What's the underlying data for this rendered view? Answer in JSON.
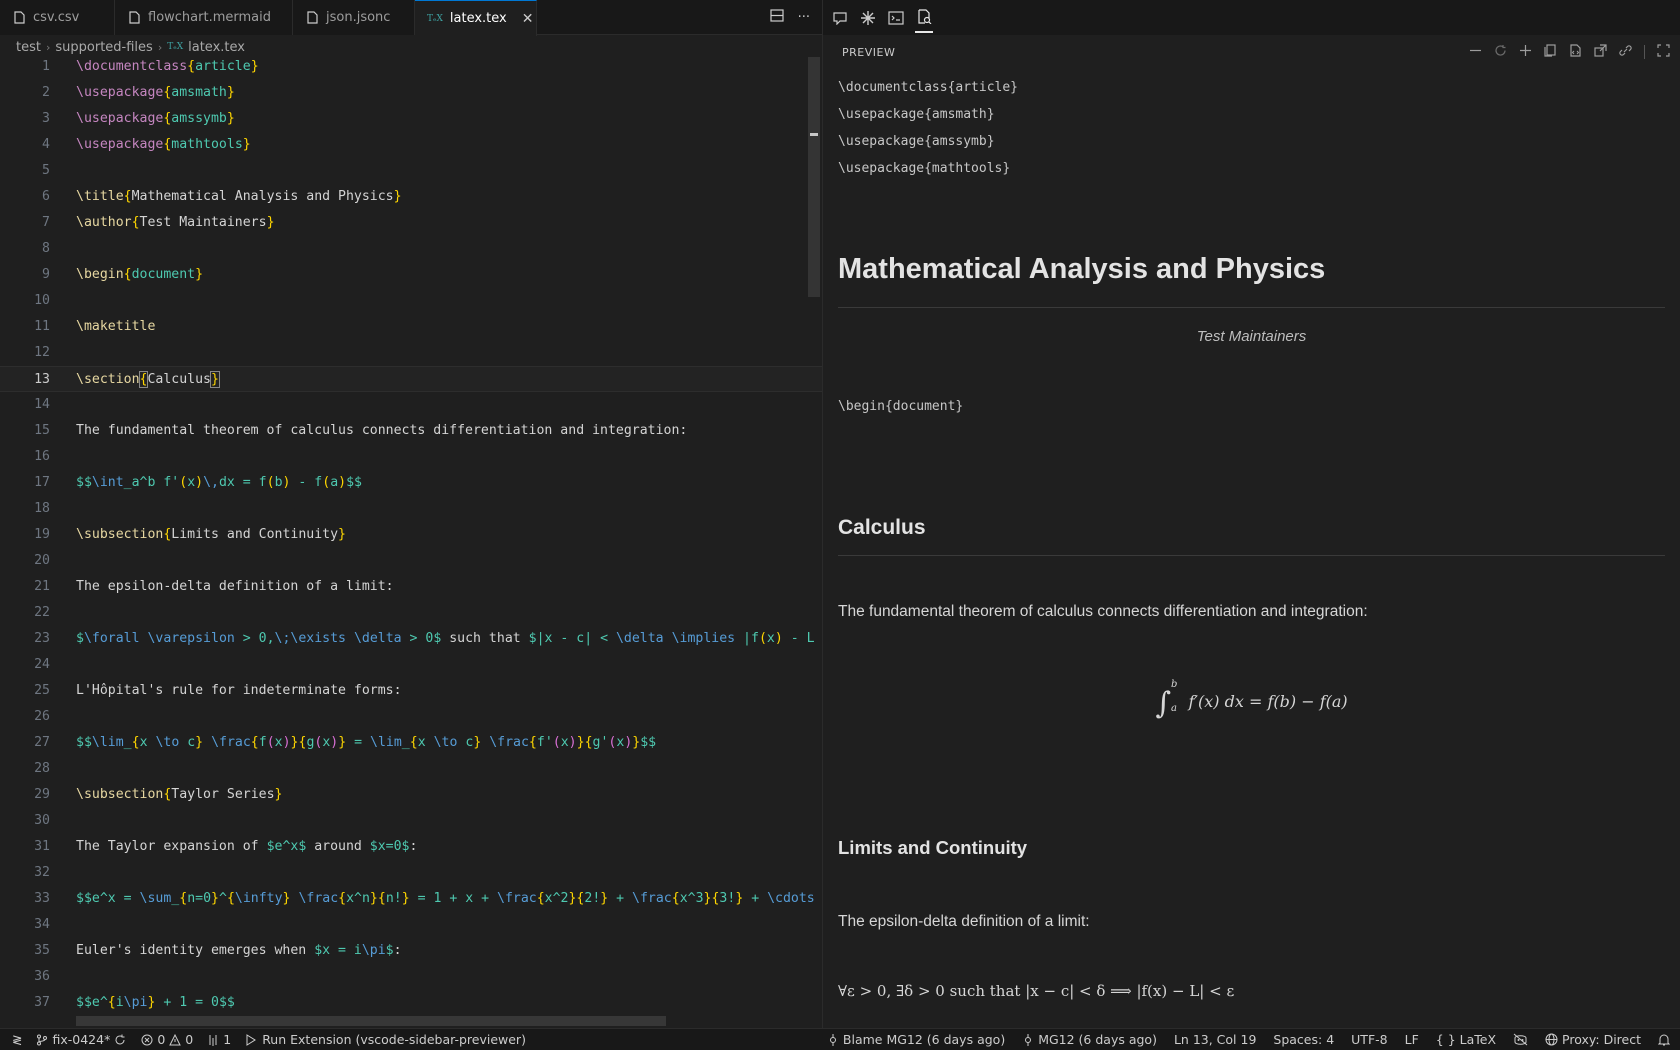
{
  "tabs": [
    {
      "label": "csv.csv",
      "icon": "file-icon",
      "active": false
    },
    {
      "label": "flowchart.mermaid",
      "icon": "file-icon",
      "active": false
    },
    {
      "label": "json.jsonc",
      "icon": "file-icon",
      "active": false
    },
    {
      "label": "latex.tex",
      "icon": "tex-icon",
      "active": true
    }
  ],
  "tab_icon_tex": "TₑX",
  "tab_close": "✕",
  "tab_actions": {
    "split": "▭",
    "more": "···"
  },
  "breadcrumb": {
    "root": "test",
    "folder": "supported-files",
    "file": "latex.tex",
    "sep": "›",
    "tex_mark": "TₑX"
  },
  "editor": {
    "current_line": 13,
    "lines": [
      {
        "n": "1",
        "html": "<span class=\"kw\">\\documentclass</span><span class=\"br\">{</span><span class=\"arg\">article</span><span class=\"br\">}</span>"
      },
      {
        "n": "2",
        "html": "<span class=\"kw\">\\usepackage</span><span class=\"br\">{</span><span class=\"arg\">amsmath</span><span class=\"br\">}</span>"
      },
      {
        "n": "3",
        "html": "<span class=\"kw\">\\usepackage</span><span class=\"br\">{</span><span class=\"arg\">amssymb</span><span class=\"br\">}</span>"
      },
      {
        "n": "4",
        "html": "<span class=\"kw\">\\usepackage</span><span class=\"br\">{</span><span class=\"arg\">mathtools</span><span class=\"br\">}</span>"
      },
      {
        "n": "5",
        "html": ""
      },
      {
        "n": "6",
        "html": "<span class=\"cmd\">\\title</span><span class=\"br\">{</span>Mathematical Analysis and Physics<span class=\"br\">}</span>"
      },
      {
        "n": "7",
        "html": "<span class=\"cmd\">\\author</span><span class=\"br\">{</span>Test Maintainers<span class=\"br\">}</span>"
      },
      {
        "n": "8",
        "html": ""
      },
      {
        "n": "9",
        "html": "<span class=\"cmd\">\\begin</span><span class=\"br\">{</span><span class=\"arg\">document</span><span class=\"br\">}</span>"
      },
      {
        "n": "10",
        "html": ""
      },
      {
        "n": "11",
        "html": "<span class=\"cmd\">\\maketitle</span>"
      },
      {
        "n": "12",
        "html": ""
      },
      {
        "n": "13",
        "html": "<span class=\"cmd\">\\section</span><span class=\"br bmatch\">{</span>Calculus<span class=\"br bmatch\">}</span>"
      },
      {
        "n": "14",
        "html": ""
      },
      {
        "n": "15",
        "html": "The fundamental theorem of calculus connects differentiation and integration:"
      },
      {
        "n": "16",
        "html": ""
      },
      {
        "n": "17",
        "html": "<span class=\"math\">$$<span class=\"mcmd\">\\int</span>_a^b f'<span class=\"br\">(</span>x<span class=\"br\">)</span><span class=\"mcmd\">\\,</span>dx = f<span class=\"br\">(</span>b<span class=\"br\">)</span> - f<span class=\"br\">(</span>a<span class=\"br\">)</span>$$</span>"
      },
      {
        "n": "18",
        "html": ""
      },
      {
        "n": "19",
        "html": "<span class=\"cmd\">\\subsection</span><span class=\"br\">{</span>Limits and Continuity<span class=\"br\">}</span>"
      },
      {
        "n": "20",
        "html": ""
      },
      {
        "n": "21",
        "html": "The epsilon-delta definition of a limit:"
      },
      {
        "n": "22",
        "html": ""
      },
      {
        "n": "23",
        "html": "<span class=\"math\">$<span class=\"mcmd\">\\forall</span> <span class=\"mcmd\">\\varepsilon</span> &gt; 0,<span class=\"mcmd\">\\;</span><span class=\"mcmd\">\\exists</span> <span class=\"mcmd\">\\delta</span> &gt; 0$</span> such that <span class=\"math\">$|x - c| &lt; <span class=\"mcmd\">\\delta</span> <span class=\"mcmd\">\\implies</span> |f<span class=\"br\">(</span>x<span class=\"br\">)</span> - L</span>"
      },
      {
        "n": "24",
        "html": ""
      },
      {
        "n": "25",
        "html": "L'Hôpital's rule for indeterminate forms:"
      },
      {
        "n": "26",
        "html": ""
      },
      {
        "n": "27",
        "html": "<span class=\"math\">$$<span class=\"mcmd\">\\lim</span>_<span class=\"br\">{</span>x <span class=\"mcmd\">\\to</span> c<span class=\"br\">}</span> <span class=\"mcmd\">\\frac</span><span class=\"br\">{</span>f<span class=\"mbr\">(</span>x<span class=\"mbr\">)</span><span class=\"br\">}{</span>g<span class=\"mbr\">(</span>x<span class=\"mbr\">)</span><span class=\"br\">}</span> = <span class=\"mcmd\">\\lim</span>_<span class=\"br\">{</span>x <span class=\"mcmd\">\\to</span> c<span class=\"br\">}</span> <span class=\"mcmd\">\\frac</span><span class=\"br\">{</span>f'<span class=\"mbr\">(</span>x<span class=\"mbr\">)</span><span class=\"br\">}{</span>g'<span class=\"mbr\">(</span>x<span class=\"mbr\">)</span><span class=\"br\">}</span>$$</span>"
      },
      {
        "n": "28",
        "html": ""
      },
      {
        "n": "29",
        "html": "<span class=\"cmd\">\\subsection</span><span class=\"br\">{</span>Taylor Series<span class=\"br\">}</span>"
      },
      {
        "n": "30",
        "html": ""
      },
      {
        "n": "31",
        "html": "The Taylor expansion of <span class=\"math\">$e^x$</span> around <span class=\"math\">$x=0$</span>:"
      },
      {
        "n": "32",
        "html": ""
      },
      {
        "n": "33",
        "html": "<span class=\"math\">$$e^x = <span class=\"mcmd\">\\sum</span>_<span class=\"br\">{</span>n=0<span class=\"br\">}</span>^<span class=\"br\">{</span><span class=\"mcmd\">\\infty</span><span class=\"br\">}</span> <span class=\"mcmd\">\\frac</span><span class=\"br\">{</span>x^n<span class=\"br\">}{</span>n!<span class=\"br\">}</span> = 1 + x + <span class=\"mcmd\">\\frac</span><span class=\"br\">{</span>x^2<span class=\"br\">}{</span>2!<span class=\"br\">}</span> + <span class=\"mcmd\">\\frac</span><span class=\"br\">{</span>x^3<span class=\"br\">}{</span>3!<span class=\"br\">}</span> + <span class=\"mcmd\">\\cdots</span></span>"
      },
      {
        "n": "34",
        "html": ""
      },
      {
        "n": "35",
        "html": "Euler's identity emerges when <span class=\"math\">$x = i<span class=\"mcmd\">\\pi</span>$</span>:"
      },
      {
        "n": "36",
        "html": ""
      },
      {
        "n": "37",
        "html": "<span class=\"math\">$$e^<span class=\"br\">{</span>i<span class=\"mcmd\">\\pi</span><span class=\"br\">}</span> + 1 = 0$$</span>"
      }
    ]
  },
  "preview": {
    "header": "PREVIEW",
    "toolbar_icons": [
      "chat-icon",
      "sparkle-icon",
      "terminal-icon",
      "preview-icon"
    ],
    "actions": [
      "minimize-icon",
      "refresh-icon",
      "add-icon",
      "copy-icon",
      "code-icon",
      "open-external-icon",
      "link-icon",
      "layout-icon"
    ],
    "preamble": [
      "\\documentclass{article}",
      "\\usepackage{amsmath}",
      "\\usepackage{amssymb}",
      "\\usepackage{mathtools}"
    ],
    "title": "Mathematical Analysis and Physics",
    "author": "Test Maintainers",
    "begin_document": "\\begin{document}",
    "section_calculus": "Calculus",
    "para_ftc": "The fundamental theorem of calculus connects differentiation and integration:",
    "ftc_formula": {
      "lhs": "f′(x) dx = f(b) − f(a)",
      "lower": "a",
      "upper": "b",
      "symbol": "∫"
    },
    "subsection_limits": "Limits and Continuity",
    "para_epsilon": "The epsilon-delta definition of a limit:",
    "epsilon_formula": "∀ε > 0, ∃δ > 0 such that |x − c| < δ ⟹ |f(x) − L| < ε"
  },
  "statusbar": {
    "remote": "≷",
    "branch": "fix-0424*",
    "errors": "0",
    "warnings": "0",
    "ports": "1",
    "run": "Run Extension (vscode-sidebar-previewer)",
    "blame": "Blame MG12 (6 days ago)",
    "commit": "MG12 (6 days ago)",
    "position": "Ln 13, Col 19",
    "spaces": "Spaces: 4",
    "encoding": "UTF-8",
    "eol": "LF",
    "language": "LaTeX",
    "proxy": "Proxy: Direct"
  }
}
